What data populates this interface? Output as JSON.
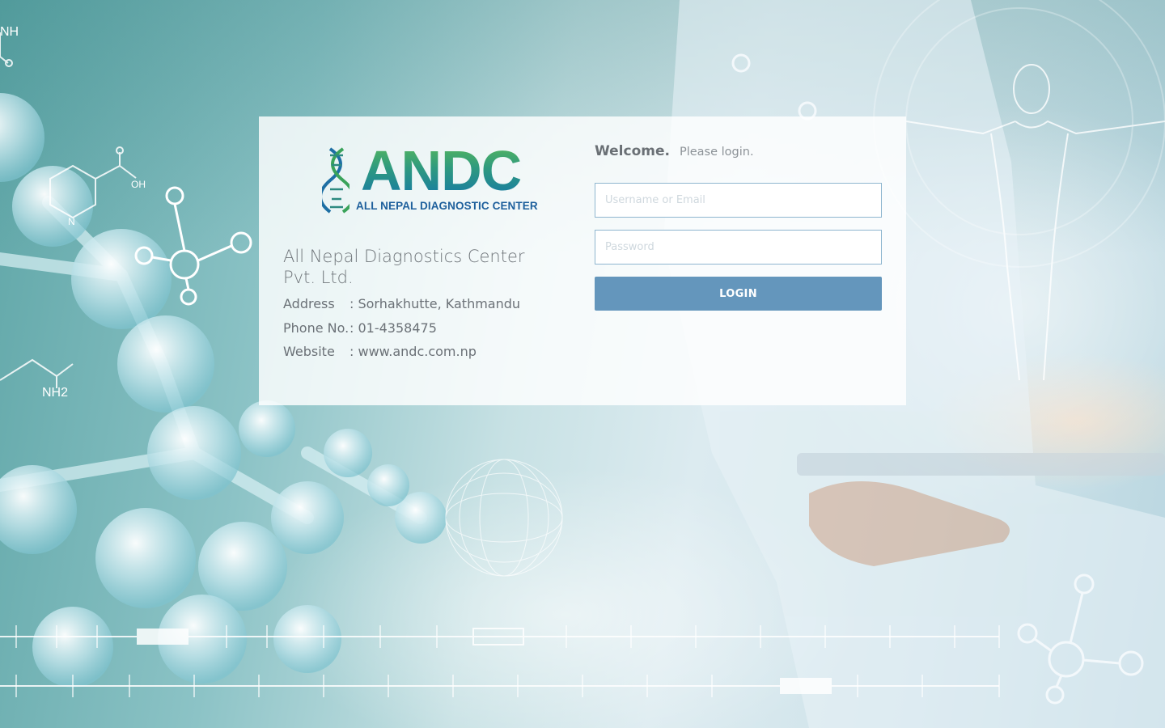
{
  "brand": {
    "logo_text": "ANDC",
    "logo_subtitle": "ALL NEPAL DIAGNOSTIC CENTER",
    "colors": {
      "logo_green": "#58b85a",
      "logo_blue": "#1679a6",
      "login_button": "#6496bc"
    }
  },
  "company": {
    "name": "All Nepal Diagnostics Center Pvt. Ltd.",
    "address_label": "Address",
    "address_value": ": Sorhakhutte, Kathmandu",
    "phone_label": "Phone No.",
    "phone_value": ": 01-4358475",
    "website_label": "Website",
    "website_value": ": www.andc.com.np"
  },
  "login": {
    "welcome": "Welcome.",
    "prompt": "Please login.",
    "username_placeholder": "Username or Email",
    "password_placeholder": "Password",
    "button_label": "LOGIN"
  },
  "background": {
    "molecule_labels": [
      "NH",
      "OH",
      "N",
      "NH2"
    ]
  }
}
